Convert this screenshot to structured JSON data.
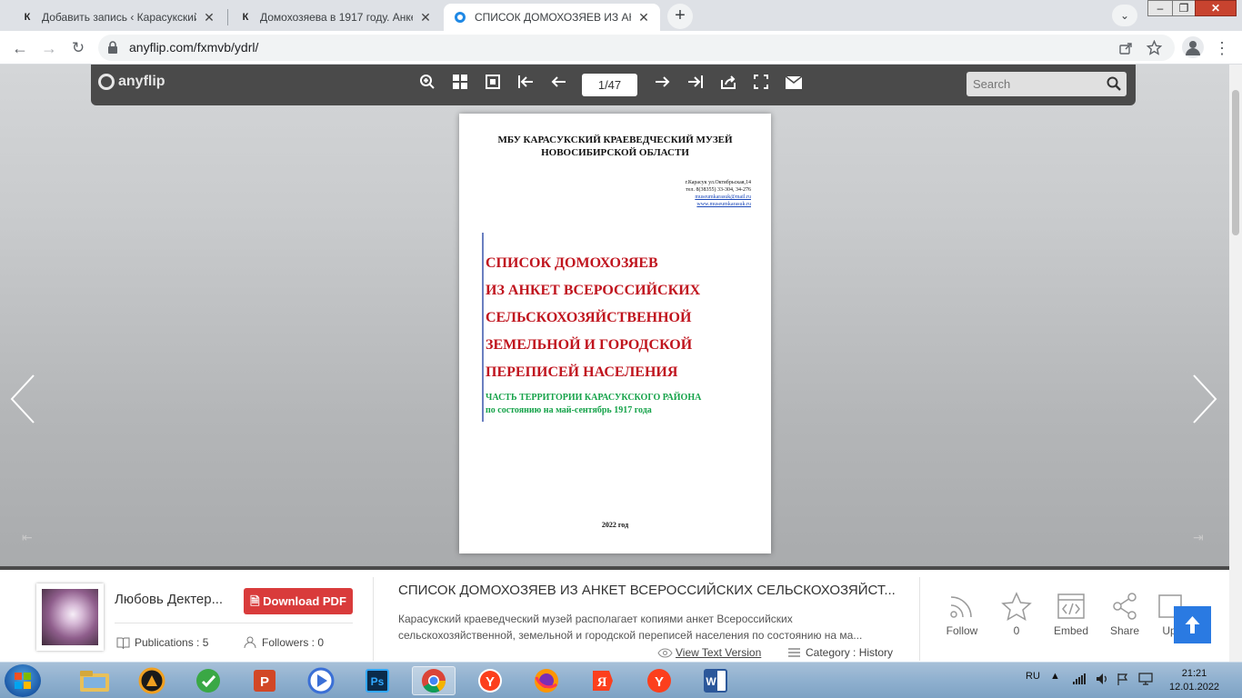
{
  "browser": {
    "tabs": [
      {
        "title": "Добавить запись ‹ Карасукский",
        "favicon": "К",
        "active": false
      },
      {
        "title": "Домохозяева в 1917 году. Анкет",
        "favicon": "К",
        "active": false
      },
      {
        "title": "СПИСОК ДОМОХОЗЯЕВ ИЗ АНК",
        "favicon": "anyflip-icon",
        "active": true
      }
    ],
    "new_tab_label": "+",
    "url": "anyflip.com/fxmvb/ydrl/"
  },
  "flip_toolbar": {
    "logo": "anyflip",
    "page_indicator": "1/47",
    "search_placeholder": "Search"
  },
  "document_page": {
    "header_line1": "МБУ КАРАСУКСКИЙ КРАЕВЕДЧЕСКИЙ МУЗЕЙ",
    "header_line2": "НОВОСИБИРСКОЙ ОБЛАСТИ",
    "address_line1": "г.Карасук ул.Октябрьская,14",
    "address_line2": "тел. 8(38355) 33-304, 34-276",
    "email": "museumkarasuk@mail.ru",
    "website": "www.museumkarasuk.ru",
    "title_lines": [
      "СПИСОК ДОМОХОЗЯЕВ",
      "ИЗ АНКЕТ ВСЕРОССИЙСКИХ",
      "СЕЛЬСКОХОЗЯЙСТВЕННОЙ",
      "ЗЕМЕЛЬНОЙ И ГОРОДСКОЙ",
      "ПЕРЕПИСЕЙ НАСЕЛЕНИЯ"
    ],
    "subtitle_line1": "ЧАСТЬ ТЕРРИТОРИИ КАРАСУКСКОГО РАЙОНА",
    "subtitle_line2": "по состоянию на май-сентябрь 1917 года",
    "year": "2022 год"
  },
  "info_panel": {
    "author": "Любовь Дектер...",
    "download_label": "Download PDF",
    "publications": "Publications : 5",
    "followers": "Followers : 0",
    "doc_title": "СПИСОК ДОМОХОЗЯЕВ ИЗ АНКЕТ ВСЕРОССИЙСКИХ СЕЛЬСКОХОЗЯЙСТ...",
    "description_line1": "Карасукский краеведческий музей располагает копиями анкет Всероссийских",
    "description_line2": "сельскохозяйственной, земельной и городской переписей населения по состоянию на ма...",
    "view_text": "View Text Version",
    "category": "Category : History",
    "actions": {
      "follow": "Follow",
      "likes": "0",
      "embed": "Embed",
      "share": "Share",
      "upload": "Up"
    }
  },
  "taskbar": {
    "lang": "RU",
    "time": "21:21",
    "date": "12.01.2022"
  },
  "colors": {
    "accent_red": "#d93b3b",
    "doc_title_red": "#c0141e",
    "doc_sub_green": "#16a34a",
    "to_top_blue": "#2a7ae2"
  }
}
